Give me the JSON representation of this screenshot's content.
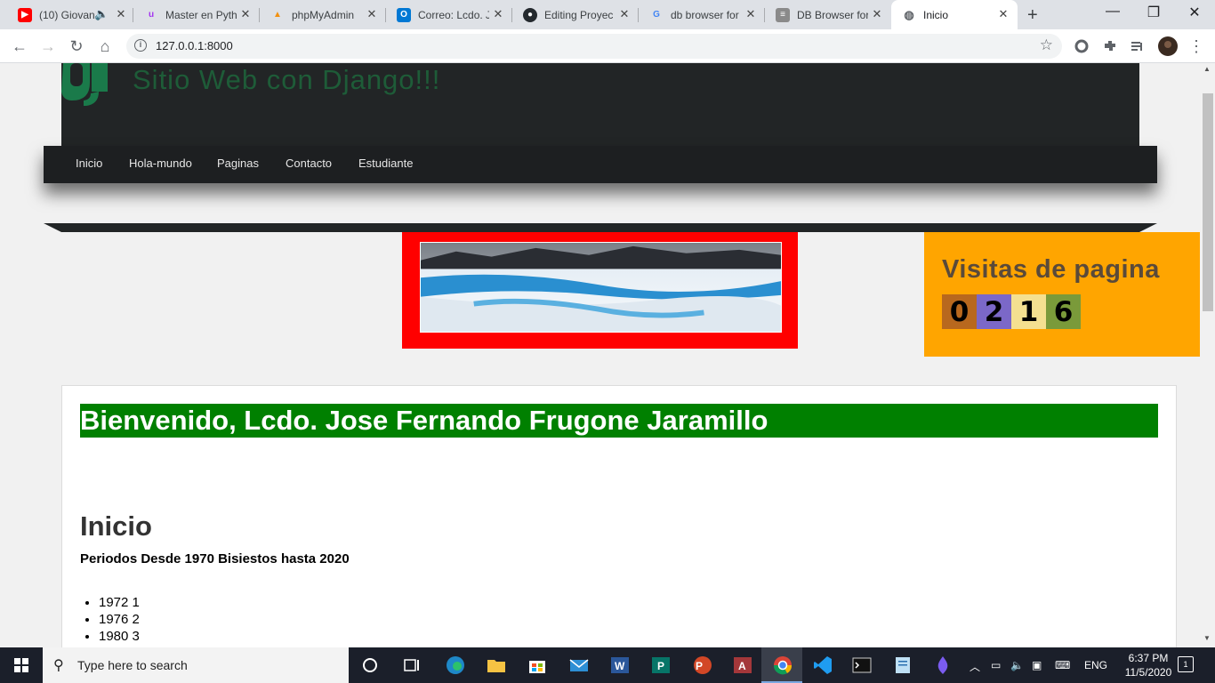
{
  "browser": {
    "tabs": [
      {
        "label": "(10) Giovan",
        "favicon": "youtube-icon",
        "color": "#ff0000"
      },
      {
        "label": "Master en Pyth",
        "favicon": "udemy-icon",
        "color": "#a435f0"
      },
      {
        "label": "phpMyAdmin",
        "favicon": "phpmyadmin-icon",
        "color": "#f29111"
      },
      {
        "label": "Correo: Lcdo. J",
        "favicon": "outlook-icon",
        "color": "#0078d4"
      },
      {
        "label": "Editing Proyec",
        "favicon": "github-icon",
        "color": "#24292e"
      },
      {
        "label": "db browser for",
        "favicon": "google-icon",
        "color": "#4285f4"
      },
      {
        "label": "DB Browser for",
        "favicon": "db-browser-icon",
        "color": "#777777"
      },
      {
        "label": "Inicio",
        "favicon": "globe-icon",
        "color": "#5f6368"
      }
    ],
    "new_tab": "+",
    "url": "127.0.0.1:8000"
  },
  "site": {
    "title": "Sitio Web con Django!!!",
    "nav": [
      "Inicio",
      "Hola-mundo",
      "Paginas",
      "Contacto",
      "Estudiante"
    ],
    "visits_title": "Visitas de pagina",
    "visit_digits": [
      "0",
      "2",
      "1",
      "6"
    ],
    "welcome": "Bienvenido, Lcdo. Jose Fernando Frugone Jaramillo",
    "heading": "Inicio",
    "subheading": "Periodos Desde 1970 Bisiestos hasta 2020",
    "years": [
      "1972 1",
      "1976 2",
      "1980 3"
    ],
    "colors": {
      "header": "#222526",
      "welcome": "#008000",
      "banner": "#ff0000",
      "visits": "#ffa500"
    }
  },
  "taskbar": {
    "search_placeholder": "Type here to search",
    "language": "ENG",
    "time": "6:37 PM",
    "date": "11/5/2020",
    "notifications": "1"
  }
}
